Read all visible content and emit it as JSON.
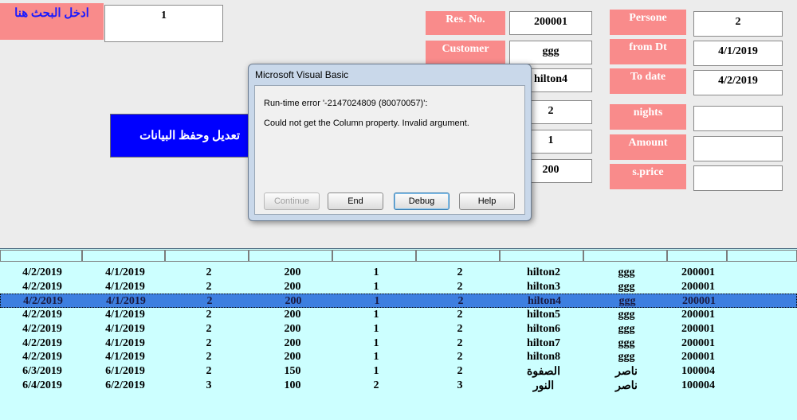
{
  "search": {
    "label": "ادخل البحث هنا",
    "value": "1"
  },
  "form": {
    "res_no": {
      "label": "Res. No.",
      "value": "200001"
    },
    "customer": {
      "label": "Customer",
      "value": "ggg"
    },
    "hotel": {
      "value": "hilton4"
    },
    "field4": {
      "value": "2"
    },
    "field5": {
      "value": "1"
    },
    "field6": {
      "value": "200"
    },
    "persons": {
      "label": "Persone",
      "value": "2"
    },
    "from_dt": {
      "label": "from Dt",
      "value": "4/1/2019"
    },
    "to_date": {
      "label": "To date",
      "value": "4/2/2019"
    },
    "nights": {
      "label": "nights",
      "value": ""
    },
    "amount": {
      "label": "Amount",
      "value": ""
    },
    "s_price": {
      "label": "s.price",
      "value": ""
    }
  },
  "save_button": {
    "label": "تعديل وحفظ البيانات"
  },
  "dialog": {
    "title": "Microsoft Visual Basic",
    "message1": "Run-time error '-2147024809 (80070057)':",
    "message2": "Could not get the Column property. Invalid argument.",
    "buttons": [
      "Continue",
      "End",
      "Debug",
      "Help"
    ]
  },
  "list": {
    "rows": [
      [
        "4/2/2019",
        "4/1/2019",
        "2",
        "200",
        "1",
        "2",
        "hilton2",
        "ggg",
        "200001"
      ],
      [
        "4/2/2019",
        "4/1/2019",
        "2",
        "200",
        "1",
        "2",
        "hilton3",
        "ggg",
        "200001"
      ],
      [
        "4/2/2019",
        "4/1/2019",
        "2",
        "200",
        "1",
        "2",
        "hilton4",
        "ggg",
        "200001"
      ],
      [
        "4/2/2019",
        "4/1/2019",
        "2",
        "200",
        "1",
        "2",
        "hilton5",
        "ggg",
        "200001"
      ],
      [
        "4/2/2019",
        "4/1/2019",
        "2",
        "200",
        "1",
        "2",
        "hilton6",
        "ggg",
        "200001"
      ],
      [
        "4/2/2019",
        "4/1/2019",
        "2",
        "200",
        "1",
        "2",
        "hilton7",
        "ggg",
        "200001"
      ],
      [
        "4/2/2019",
        "4/1/2019",
        "2",
        "200",
        "1",
        "2",
        "hilton8",
        "ggg",
        "200001"
      ],
      [
        "6/3/2019",
        "6/1/2019",
        "2",
        "150",
        "1",
        "2",
        "الصفوة",
        "ناصر",
        "100004"
      ],
      [
        "6/4/2019",
        "6/2/2019",
        "3",
        "100",
        "2",
        "3",
        "النور",
        "ناصر",
        "100004"
      ]
    ],
    "selected_index": 2
  }
}
